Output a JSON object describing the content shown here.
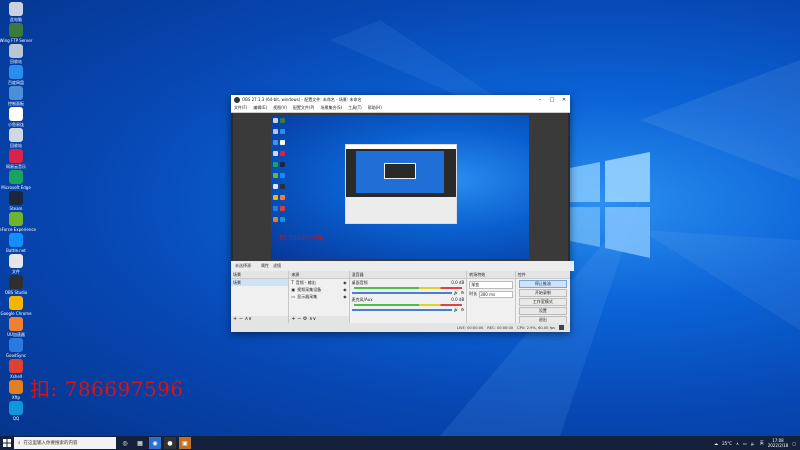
{
  "desktop": {
    "icons": [
      {
        "label": "此电脑",
        "color": "#c9d3df"
      },
      {
        "label": "Wing FTP Server",
        "color": "#3a7a3a"
      },
      {
        "label": "回收站",
        "color": "#b8c6d6"
      },
      {
        "label": "百度网盘",
        "color": "#2a8ef0"
      },
      {
        "label": "控制面板",
        "color": "#4a90d9"
      },
      {
        "label": "小鱼易连",
        "color": "#ffffff"
      },
      {
        "label": "回收站",
        "color": "#d0d8e2"
      },
      {
        "label": "网易云音乐",
        "color": "#d9214a"
      },
      {
        "label": "Microsoft Edge",
        "color": "#1aa260"
      },
      {
        "label": "Steam",
        "color": "#1b2838"
      },
      {
        "label": "GeForce Experience",
        "color": "#6fb52b"
      },
      {
        "label": "Battle.net",
        "color": "#148eff"
      },
      {
        "label": "文件",
        "color": "#e6e6e6"
      },
      {
        "label": "OBS Studio",
        "color": "#302e31"
      },
      {
        "label": "Google Chrome",
        "color": "#f4b400"
      },
      {
        "label": "UU加速器",
        "color": "#f08030"
      },
      {
        "label": "GoodSync",
        "color": "#2a7ae2"
      },
      {
        "label": "Xshell",
        "color": "#e04030"
      },
      {
        "label": "Xftp",
        "color": "#e08020"
      },
      {
        "label": "QQ",
        "color": "#1296db"
      }
    ],
    "qq_text": "扣: 786697596"
  },
  "obs": {
    "title": "OBS 27.1.3 (64-bit, windows) - 配置文件: 未命名 - 场景: 未命名",
    "menu": [
      "文件(F)",
      "编辑(E)",
      "视图(V)",
      "配置文件(P)",
      "场景集合(S)",
      "工具(T)",
      "帮助(H)"
    ],
    "preview_qq": "扣: 786697596",
    "no_source_label": "未选择源",
    "properties_label": "属性",
    "filters_label": "滤镜",
    "docks": {
      "scenes": {
        "title": "场景",
        "items": [
          "场景"
        ]
      },
      "sources": {
        "title": "来源",
        "items": [
          "音频 - 输出",
          "视频采集设备",
          "显示器采集"
        ]
      },
      "mixer": {
        "title": "混音器",
        "tracks": [
          {
            "name": "桌面音频",
            "level": "0.0 dB"
          },
          {
            "name": "麦克风/Aux",
            "level": "0.0 dB"
          }
        ]
      },
      "transitions": {
        "title": "转场特效",
        "type": "渐变",
        "duration_label": "时长",
        "duration": "300 ms"
      },
      "controls": {
        "title": "控件",
        "buttons": [
          "停止推流",
          "开始录制",
          "工作室模式",
          "设置",
          "退出"
        ]
      }
    },
    "status": {
      "live": "LIVE: 00:00:00",
      "rec": "REC: 00:00:00",
      "cpu": "CPU: 2.9%, 60.00 fps"
    }
  },
  "taskbar": {
    "search_placeholder": "在这里输入你要搜索的内容",
    "weather": "25°C",
    "lang": "英",
    "time": "17:08",
    "date": "2022/2/18"
  }
}
